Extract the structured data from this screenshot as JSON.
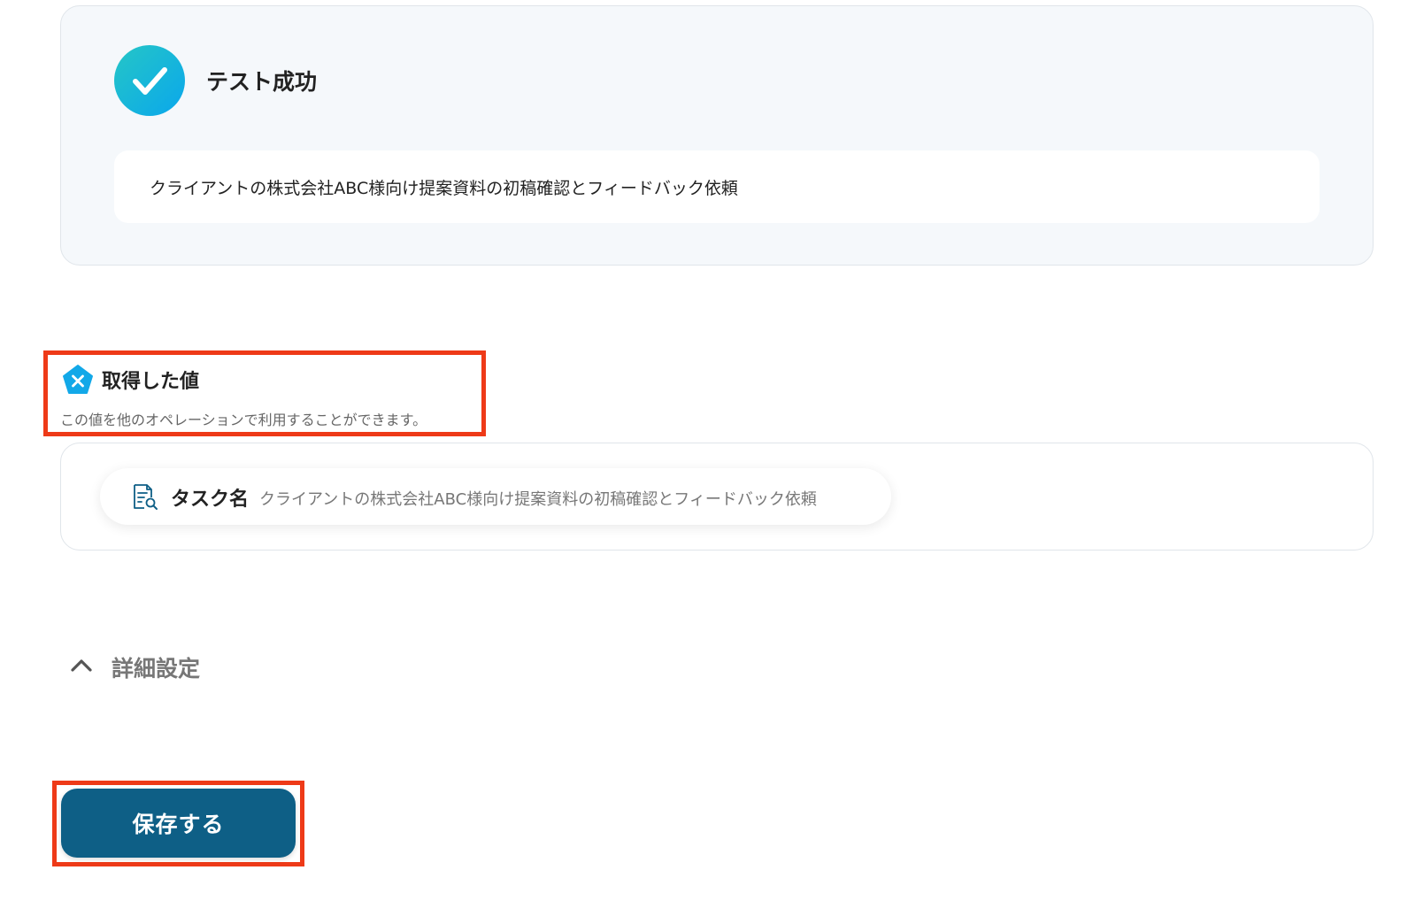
{
  "test_result": {
    "status_icon": "check-circle-icon",
    "title": "テスト成功",
    "output_text": "クライアントの株式会社ABC様向け提案資料の初稿確認とフィードバック依頼"
  },
  "obtained_values": {
    "icon": "variable-pentagon-icon",
    "title": "取得した値",
    "description": "この値を他のオペレーションで利用することができます。",
    "items": [
      {
        "icon": "document-search-icon",
        "label": "タスク名",
        "value": "クライアントの株式会社ABC様向け提案資料の初稿確認とフィードバック依頼"
      }
    ]
  },
  "advanced_settings": {
    "icon": "chevron-up-icon",
    "label": "詳細設定"
  },
  "actions": {
    "save_label": "保存する"
  },
  "colors": {
    "success_gradient_start": "#25c6c6",
    "success_gradient_end": "#0aa7ec",
    "primary_button": "#0e5f86",
    "highlight_border": "#ee3a18",
    "panel_background": "#f5f8fb"
  }
}
